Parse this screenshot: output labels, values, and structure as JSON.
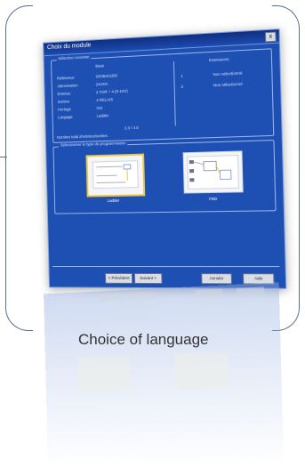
{
  "window": {
    "title": "Choix du module",
    "close_glyph": "x"
  },
  "module_group": {
    "label": "Sélection courante",
    "rows": [
      {
        "key": "Référence",
        "value": "SR3B101BD"
      },
      {
        "key": "Alimentation",
        "value": "24VDC"
      },
      {
        "key": "Entrées",
        "value": "2 TOR + 4 (0-10V)"
      },
      {
        "key": "Sorties",
        "value": "4 RELAIS"
      },
      {
        "key": "Horloge",
        "value": "Oui"
      },
      {
        "key": "Langage",
        "value": "Ladder"
      }
    ],
    "name": "Base",
    "version": "2.3 / 4.5",
    "extensions_title": "Extensions",
    "extensions": [
      {
        "slot": "1",
        "status": "Non sélectionné"
      },
      {
        "slot": "2",
        "status": "Non sélectionné"
      }
    ],
    "footer": "Nombre total d'entrées/sorties"
  },
  "language_group": {
    "label": "Sélectionner le type de programmation",
    "options": [
      {
        "name": "Ladder",
        "selected": true
      },
      {
        "name": "FBD",
        "selected": false
      }
    ]
  },
  "buttons": {
    "prev": "< Précédent",
    "next": "Suivant >",
    "cancel": "Annuler",
    "help": "Aide"
  },
  "caption": "Choice of language"
}
